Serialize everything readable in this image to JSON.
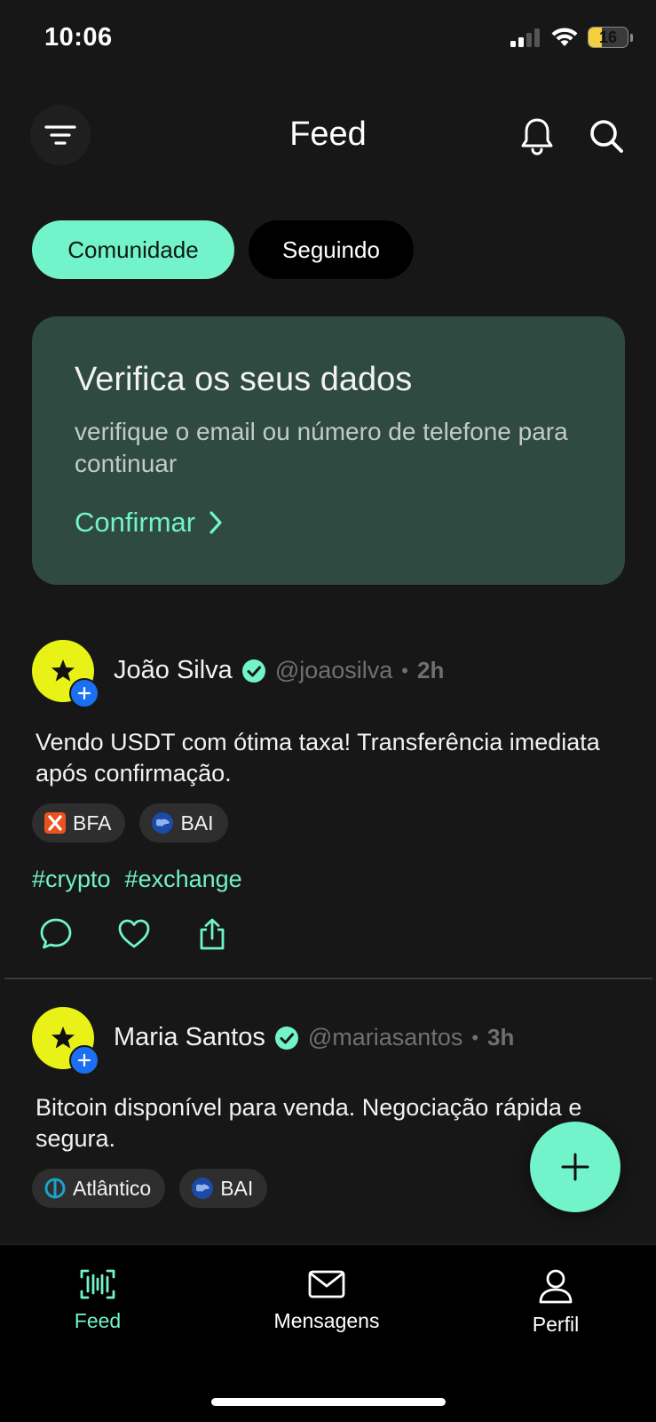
{
  "status_bar": {
    "time": "10:06",
    "battery": "16"
  },
  "header": {
    "title": "Feed"
  },
  "tabs": [
    {
      "label": "Comunidade",
      "active": true
    },
    {
      "label": "Seguindo",
      "active": false
    }
  ],
  "verify_card": {
    "title": "Verifica os seus dados",
    "text": "verifique o email ou número de telefone para continuar",
    "action": "Confirmar"
  },
  "posts": [
    {
      "author": "João Silva",
      "handle": "@joaosilva",
      "time": "2h",
      "text": "Vendo USDT com ótima taxa! Transferência imediata após confirmação.",
      "banks": [
        "BFA",
        "BAI"
      ],
      "hashtags": [
        "#crypto",
        "#exchange"
      ]
    },
    {
      "author": "Maria Santos",
      "handle": "@mariasantos",
      "time": "3h",
      "text": "Bitcoin disponível para venda. Negociação rápida e segura.",
      "banks": [
        "Atlântico",
        "BAI"
      ]
    }
  ],
  "bottom_nav": [
    {
      "label": "Feed",
      "icon": "barcode-icon",
      "active": true
    },
    {
      "label": "Mensagens",
      "icon": "mail-icon",
      "active": false
    },
    {
      "label": "Perfil",
      "icon": "user-icon",
      "active": false
    }
  ],
  "colors": {
    "accent": "#72f3c9",
    "background": "#171717",
    "card": "#2f4a41",
    "avatar": "#e8f217",
    "follow_badge": "#1b6ff2"
  }
}
